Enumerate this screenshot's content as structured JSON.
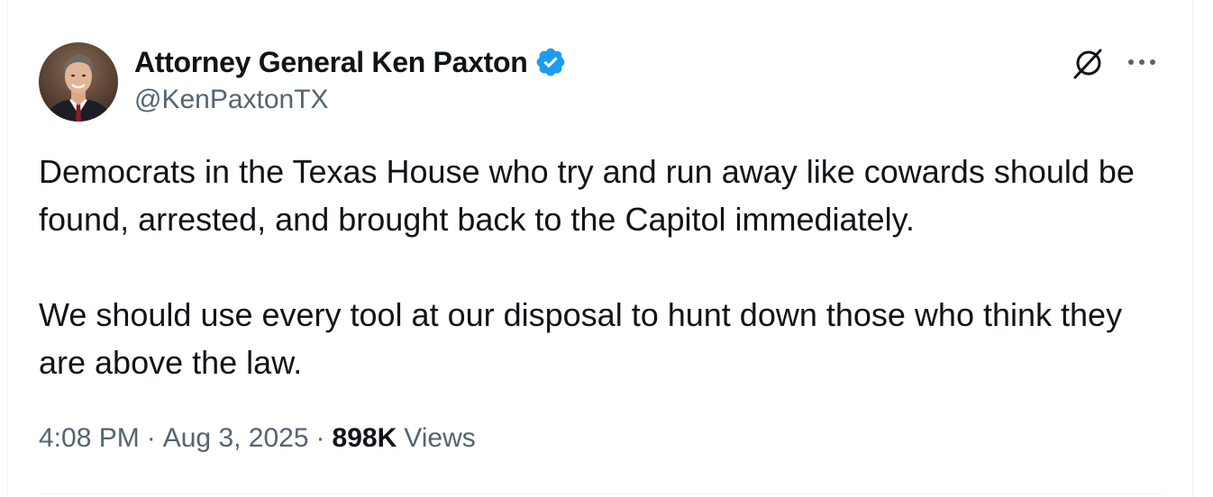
{
  "author": {
    "display_name": "Attorney General Ken Paxton",
    "handle": "@KenPaxtonTX",
    "verified": true,
    "verified_color": "#1d9bf0"
  },
  "tweet": {
    "paragraphs": [
      "Democrats in the Texas House who try and run away like cowards should be found, arrested, and brought back to the Capitol immediately.",
      "We should use every tool at our disposal to hunt down those who think they are above the law."
    ]
  },
  "meta": {
    "time": "4:08 PM",
    "separator": "·",
    "date": "Aug 3, 2025",
    "views_count": "898K",
    "views_label": "Views"
  },
  "icons": {
    "avatar": "avatar",
    "verified": "verified-badge-icon",
    "grok": "grok-icon",
    "more": "more-options-icon"
  },
  "colors": {
    "text_primary": "#0f1419",
    "text_secondary": "#536471",
    "accent": "#1d9bf0"
  }
}
